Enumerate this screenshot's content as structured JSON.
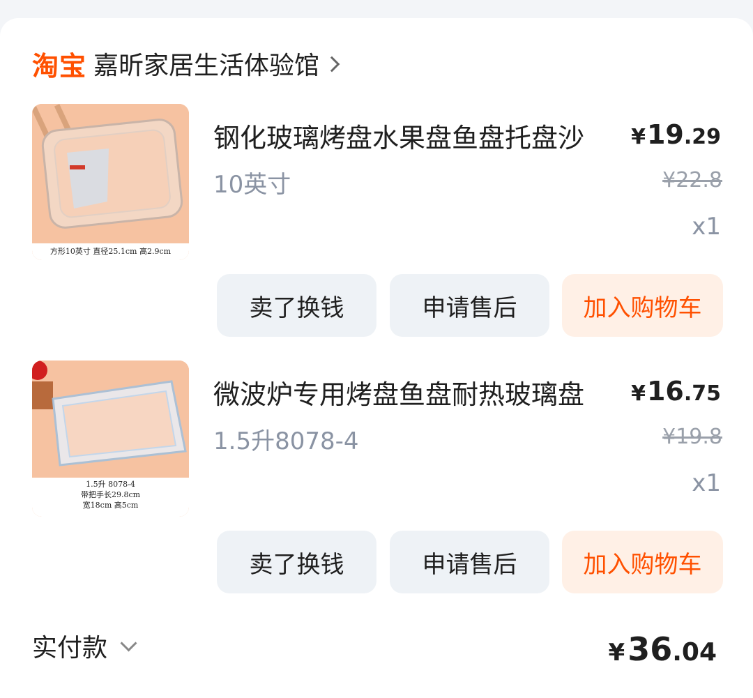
{
  "shop": {
    "logo": "淘宝",
    "name": "嘉昕家居生活体验馆"
  },
  "items": [
    {
      "title": "钢化玻璃烤盘水果盘鱼盘托盘沙",
      "spec": "10英寸",
      "price_currency": "¥",
      "price_int": "19",
      "price_dec": ".29",
      "original_price": "¥22.8",
      "quantity": "x1",
      "thumb_caption": "方形10英寸  直径25.1cm  高2.9cm",
      "buttons": {
        "sell": "卖了换钱",
        "after_sale": "申请售后",
        "add_cart": "加入购物车"
      }
    },
    {
      "title": "微波炉专用烤盘鱼盘耐热玻璃盘",
      "spec": "1.5升8078-4",
      "price_currency": "¥",
      "price_int": "16",
      "price_dec": ".75",
      "original_price": "¥19.8",
      "quantity": "x1",
      "thumb_caption_1": "1.5升   8078-4",
      "thumb_caption_2": "带把手长29.8cm",
      "thumb_caption_3": "宽18cm 高5cm",
      "buttons": {
        "sell": "卖了换钱",
        "after_sale": "申请售后",
        "add_cart": "加入购物车"
      }
    }
  ],
  "payment": {
    "label": "实付款",
    "currency": "¥",
    "total_int": "36",
    "total_dec": ".04"
  },
  "colors": {
    "accent": "#ff5000",
    "muted": "#8a93a3",
    "button_bg": "#eef2f6",
    "cart_bg": "#fff0e6"
  }
}
